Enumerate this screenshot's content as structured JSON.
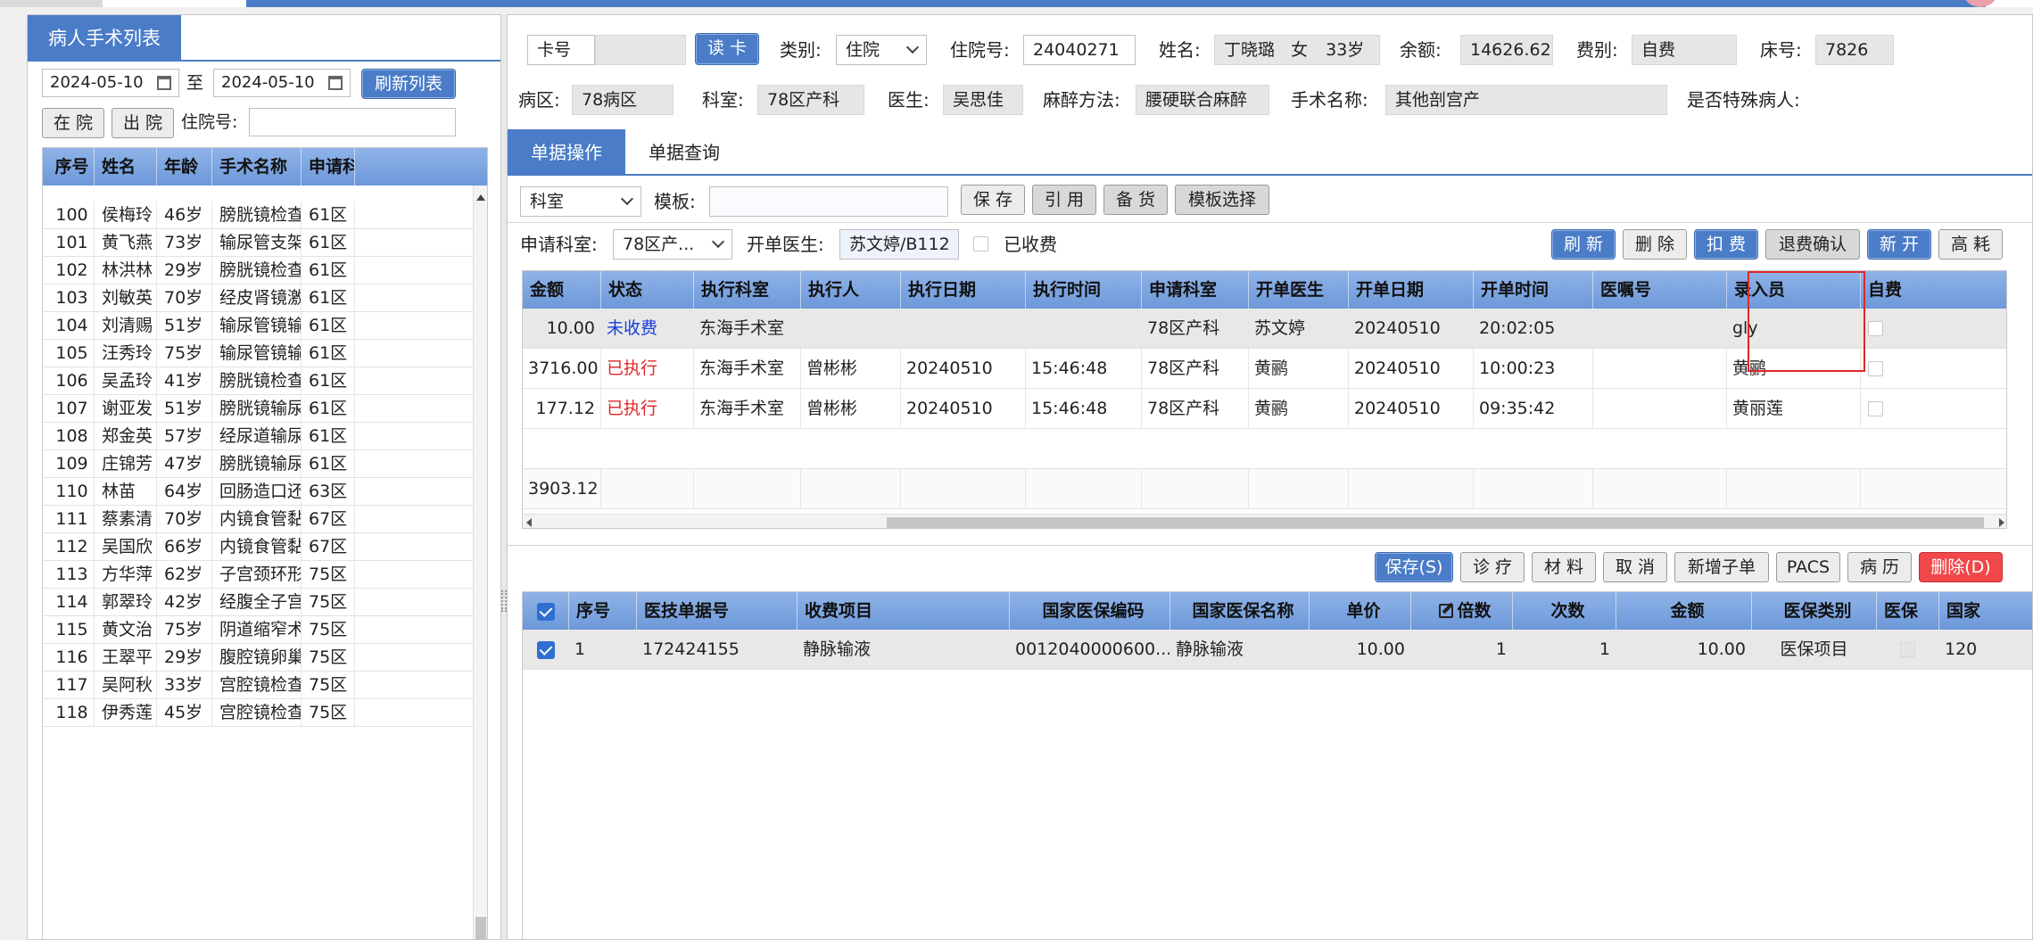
{
  "left": {
    "title": "病人手术列表",
    "date_from": "2024-05-10",
    "date_sep": "至",
    "date_to": "2024-05-10",
    "refresh_btn": "刷新列表",
    "in_hospital_btn": "在 院",
    "out_hospital_btn": "出 院",
    "admission_label": "住院号:",
    "columns": [
      "序号",
      "姓名",
      "年龄",
      "手术名称",
      "申请科"
    ],
    "rows": [
      [
        "100",
        "侯梅玲",
        "46岁",
        "膀胱镜检查",
        "61区"
      ],
      [
        "101",
        "黄飞燕",
        "73岁",
        "输尿管支架...",
        "61区"
      ],
      [
        "102",
        "林洪林",
        "29岁",
        "膀胱镜检查",
        "61区"
      ],
      [
        "103",
        "刘敏英",
        "70岁",
        "经皮肾镜激...",
        "61区"
      ],
      [
        "104",
        "刘清赐",
        "51岁",
        "输尿管镜输...",
        "61区"
      ],
      [
        "105",
        "汪秀玲",
        "75岁",
        "输尿管镜输...",
        "61区"
      ],
      [
        "106",
        "吴孟玲",
        "41岁",
        "膀胱镜检查",
        "61区"
      ],
      [
        "107",
        "谢亚发",
        "51岁",
        "膀胱镜输尿...",
        "61区"
      ],
      [
        "108",
        "郑金英",
        "57岁",
        "经尿道输尿...",
        "61区"
      ],
      [
        "109",
        "庄锦芳",
        "47岁",
        "膀胱镜输尿...",
        "61区"
      ],
      [
        "110",
        "林苗",
        "64岁",
        "回肠造口还...",
        "63区"
      ],
      [
        "111",
        "蔡素清",
        "70岁",
        "内镜食管黏...",
        "67区"
      ],
      [
        "112",
        "吴国欣",
        "66岁",
        "内镜食管黏...",
        "67区"
      ],
      [
        "113",
        "方华萍",
        "62岁",
        "子宫颈环形...",
        "75区"
      ],
      [
        "114",
        "郭翠玲",
        "42岁",
        "经腹全子宫...",
        "75区"
      ],
      [
        "115",
        "黄文治",
        "75岁",
        "阴道缩窄术",
        "75区"
      ],
      [
        "116",
        "王翠平",
        "29岁",
        "腹腔镜卵巢...",
        "75区"
      ],
      [
        "117",
        "吴阿秋",
        "33岁",
        "宫腔镜检查",
        "75区"
      ],
      [
        "118",
        "伊秀莲",
        "45岁",
        "宫腔镜检查",
        "75区"
      ]
    ]
  },
  "header": {
    "card_label": "卡号",
    "read_card_btn": "读 卡",
    "category_label": "类别:",
    "category_value": "住院",
    "admission_label": "住院号:",
    "admission_value": "24040271",
    "name_label": "姓名:",
    "name_value": "丁晓璐",
    "gender_value": "女",
    "age_value": "33岁",
    "balance_label": "余额:",
    "balance_value": "14626.62",
    "fee_label": "费别:",
    "fee_value": "自费",
    "bed_label": "床号:",
    "bed_value": "7826",
    "ward_label": "病区:",
    "ward_value": "78病区",
    "dept_label": "科室:",
    "dept_value": "78区产科",
    "doctor_label": "医生:",
    "doctor_value": "吴思佳",
    "anesthesia_label": "麻醉方法:",
    "anesthesia_value": "腰硬联合麻醉",
    "surgery_label": "手术名称:",
    "surgery_value": "其他剖宫产",
    "special_label": "是否特殊病人:"
  },
  "tabs": {
    "active": "单据操作",
    "other": "单据查询"
  },
  "toolbar1": {
    "dept_select": "科室",
    "template_label": "模板:",
    "save_btn": "保 存",
    "cite_btn": "引 用",
    "stock_btn": "备 货",
    "template_select_btn": "模板选择"
  },
  "toolbar2": {
    "req_dept_label": "申请科室:",
    "req_dept_value": "78区产...",
    "doctor_label": "开单医生:",
    "doctor_value": "苏文婷/B112",
    "charged_label": "已收费",
    "refresh_btn": "刷 新",
    "delete_btn": "删 除",
    "deduct_btn": "扣 费",
    "refund_btn": "退费确认",
    "new_btn": "新 开",
    "high_btn": "高 耗"
  },
  "orders": {
    "columns": [
      "金额",
      "状态",
      "执行科室",
      "执行人",
      "执行日期",
      "执行时间",
      "申请科室",
      "开单医生",
      "开单日期",
      "开单时间",
      "医嘱号",
      "录入员",
      "自费"
    ],
    "rows": [
      [
        "10.00",
        "未收费",
        "东海手术室",
        "",
        "",
        "",
        "78区产科",
        "苏文婷",
        "20240510",
        "20:02:05",
        "",
        "gly",
        ""
      ],
      [
        "3716.00",
        "已执行",
        "东海手术室",
        "曾彬彬",
        "20240510",
        "15:46:48",
        "78区产科",
        "黄鹂",
        "20240510",
        "10:00:23",
        "",
        "黄鹂",
        ""
      ],
      [
        "177.12",
        "已执行",
        "东海手术室",
        "曾彬彬",
        "20240510",
        "15:46:48",
        "78区产科",
        "黄鹂",
        "20240510",
        "09:35:42",
        "",
        "黄丽莲",
        ""
      ]
    ],
    "total": "3903.12"
  },
  "toolbar3": {
    "save_btn": "保存(S)",
    "diagnosis_btn": "诊 疗",
    "material_btn": "材 料",
    "cancel_btn": "取 消",
    "add_child_btn": "新增子单",
    "pacs_btn": "PACS",
    "record_btn": "病 历",
    "delete_btn": "删除(D)"
  },
  "items": {
    "columns": [
      "序号",
      "医技单据号",
      "收费项目",
      "国家医保编码",
      "国家医保名称",
      "单价",
      "倍数",
      "次数",
      "金额",
      "医保类别",
      "医保",
      "国家"
    ],
    "rows": [
      [
        "1",
        "172424155",
        "静脉输液",
        "0012040000600...",
        "静脉输液",
        "10.00",
        "1",
        "1",
        "10.00",
        "医保项目",
        "",
        "120"
      ]
    ]
  },
  "colors": {
    "accent": "#4a7cc7",
    "danger": "#f0484b",
    "status_executed": "#e0262a",
    "status_uncharged": "#1a3cd9"
  }
}
